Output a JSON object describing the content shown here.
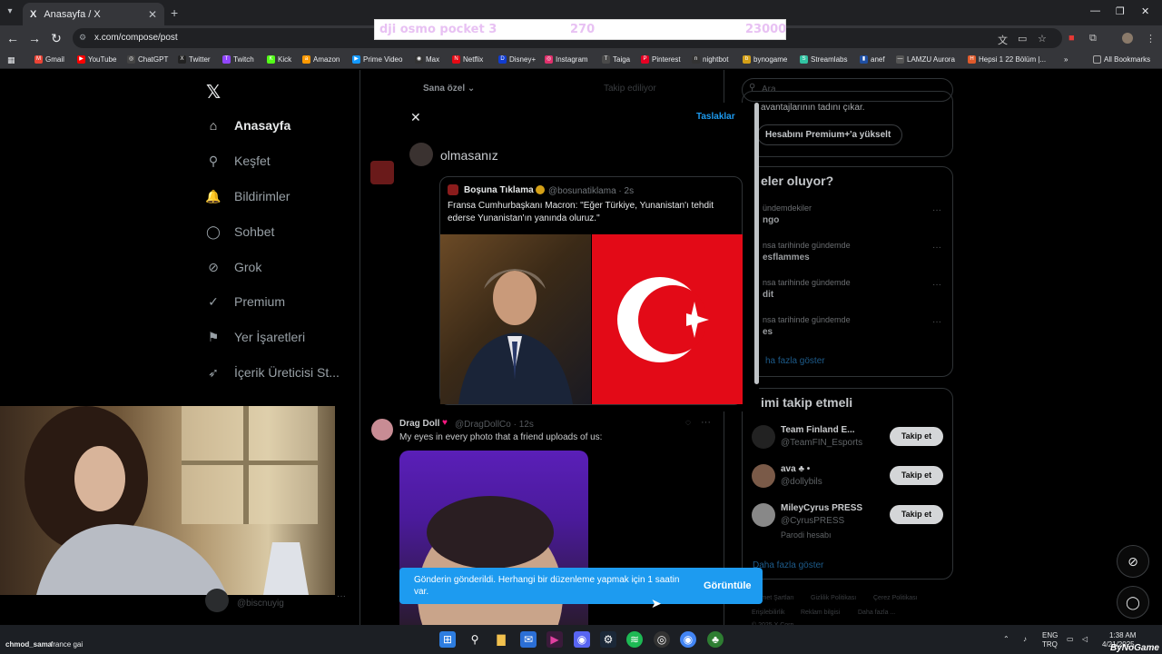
{
  "browser": {
    "tab_title": "Anasayfa / X",
    "tab_favicon": "X",
    "url": "x.com/compose/post",
    "overlay": {
      "item": "dji osmo pocket 3",
      "qty": "270",
      "price": "23000"
    },
    "bookmarks": [
      {
        "label": "Gmail",
        "color": "#ea4335",
        "glyph": "M"
      },
      {
        "label": "YouTube",
        "color": "#ff0000",
        "glyph": "▶"
      },
      {
        "label": "ChatGPT",
        "color": "#444",
        "glyph": "◎"
      },
      {
        "label": "Twitter",
        "color": "#222",
        "glyph": "X"
      },
      {
        "label": "Twitch",
        "color": "#9146ff",
        "glyph": "T"
      },
      {
        "label": "Kick",
        "color": "#53fc18",
        "glyph": "K"
      },
      {
        "label": "Amazon",
        "color": "#ff9900",
        "glyph": "a"
      },
      {
        "label": "Prime Video",
        "color": "#1399ff",
        "glyph": "▶"
      },
      {
        "label": "Max",
        "color": "#333",
        "glyph": "◉"
      },
      {
        "label": "Netflix",
        "color": "#e50914",
        "glyph": "N"
      },
      {
        "label": "Disney+",
        "color": "#113ccf",
        "glyph": "D"
      },
      {
        "label": "Instagram",
        "color": "#e1306c",
        "glyph": "◎"
      },
      {
        "label": "Taiga",
        "color": "#4a4a4a",
        "glyph": "T"
      },
      {
        "label": "Pinterest",
        "color": "#e60023",
        "glyph": "P"
      },
      {
        "label": "nightbot",
        "color": "#333",
        "glyph": "n"
      },
      {
        "label": "bynogame",
        "color": "#d4a017",
        "glyph": "b"
      },
      {
        "label": "Streamlabs",
        "color": "#31c3a2",
        "glyph": "S"
      },
      {
        "label": "anef",
        "color": "#1f4fa3",
        "glyph": "▮"
      },
      {
        "label": "LAMZU Aurora",
        "color": "#555",
        "glyph": "—"
      },
      {
        "label": "Hepsi 1 22 Bölüm |...",
        "color": "#e05a2b",
        "glyph": "H"
      }
    ],
    "all_bookmarks": "All Bookmarks",
    "more_bookmarks": "»"
  },
  "nav": {
    "items": [
      {
        "label": "Anasayfa",
        "icon": "home-icon",
        "glyph": "⌂"
      },
      {
        "label": "Keşfet",
        "icon": "search-icon",
        "glyph": "⚲"
      },
      {
        "label": "Bildirimler",
        "icon": "bell-icon",
        "glyph": "🔔"
      },
      {
        "label": "Sohbet",
        "icon": "chat-icon",
        "glyph": "◯"
      },
      {
        "label": "Grok",
        "icon": "grok-icon",
        "glyph": "⊘"
      },
      {
        "label": "Premium",
        "icon": "premium-icon",
        "glyph": "✓"
      },
      {
        "label": "Yer İşaretleri",
        "icon": "bookmark-icon",
        "glyph": "⚑"
      },
      {
        "label": "İçerik Üreticisi St...",
        "icon": "rocket-icon",
        "glyph": "➶"
      }
    ],
    "user_handle": "@biscnuyig"
  },
  "feed": {
    "tab_for_you": "Sana özel",
    "tab_following": "Takip ediliyor"
  },
  "compose": {
    "drafts": "Taslaklar",
    "text": "olmasanız",
    "quote": {
      "name": "Boşuna Tıklama",
      "handle": "@bosunatiklama · 2s",
      "text": "Fransa Cumhurbaşkanı Macron: \"Eğer Türkiye, Yunanistan'ı tehdit ederse Yunanistan'ın yanında oluruz.\""
    }
  },
  "post": {
    "name": "Drag Doll",
    "handle": "@DragDollCo · 12s",
    "text": "My eyes in every photo that a friend uploads of us:"
  },
  "toast": {
    "text": "Gönderin gönderildi. Herhangi bir düzenleme yapmak için 1 saatin var.",
    "button": "Görüntüle"
  },
  "sidebar": {
    "search_placeholder": "Ara",
    "premium_text": "avantajlarının tadını çıkar.",
    "premium_button": "Hesabını Premium+'a yükselt",
    "trends_title": "eler oluyor?",
    "trends": [
      {
        "meta": "ündemdekiler",
        "title": "ngo"
      },
      {
        "meta": "nsa tarihinde gündemde",
        "title": "esflammes"
      },
      {
        "meta": "nsa tarihinde gündemde",
        "title": "dit"
      },
      {
        "meta": "nsa tarihinde gündemde",
        "title": "es"
      }
    ],
    "trends_more": "ha fazla göster",
    "follow_title": "imi takip etmeli",
    "follow": [
      {
        "name": "Team Finland E...",
        "handle": "@TeamFIN_Esports",
        "button": "Takip et",
        "color": "#222"
      },
      {
        "name": "ava ♣ •",
        "handle": "@dollybils",
        "button": "Takip et",
        "color": "#7a5a48"
      },
      {
        "name": "MileyCyrus PRESS",
        "handle": "@CyrusPRESS",
        "extra": "Parodi hesabı",
        "button": "Takip et",
        "color": "#888"
      }
    ],
    "follow_more": "Daha fazla göster",
    "footer": [
      "zmet Şartları",
      "Gizlilik Politikası",
      "Çerez Politikası",
      "Erişilebilirlik",
      "Reklam bilgisi",
      "Daha fazla ...",
      "© 2025 X Corp."
    ]
  },
  "stream": {
    "chat_user": "chmod_sama",
    "chat_msg": "france gai",
    "watermark": "ByNoGame"
  },
  "taskbar": {
    "lang": "ENG",
    "layout": "TRQ",
    "time": "1:38 AM",
    "date": "4/21/2025"
  }
}
